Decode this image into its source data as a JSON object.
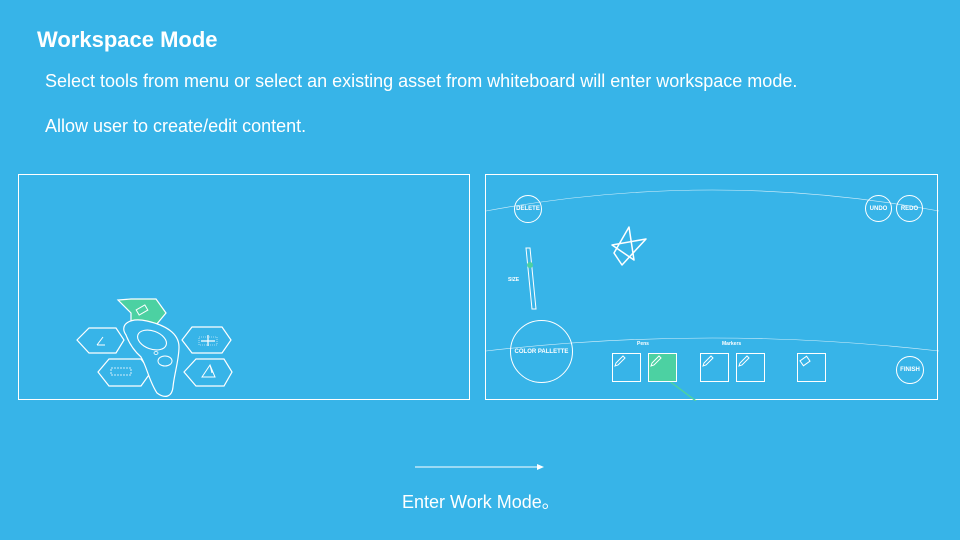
{
  "title": "Workspace Mode",
  "descriptions": [
    "Select tools from menu or select an existing asset from whiteboard will enter workspace mode.",
    "Allow user to create/edit content."
  ],
  "workspace": {
    "delete_label": "DELETE",
    "undo_label": "UNDO",
    "redo_label": "REDO",
    "finish_label": "FINISH",
    "size_label": "SIZE",
    "color_palette_label": "COLOR PALLETTE",
    "pens_label": "Pens",
    "markers_label": "Markers"
  },
  "caption": "Enter Work Mode。",
  "colors": {
    "background": "#37b4e8",
    "foreground": "#ffffff",
    "accent": "#4cd1a2"
  }
}
